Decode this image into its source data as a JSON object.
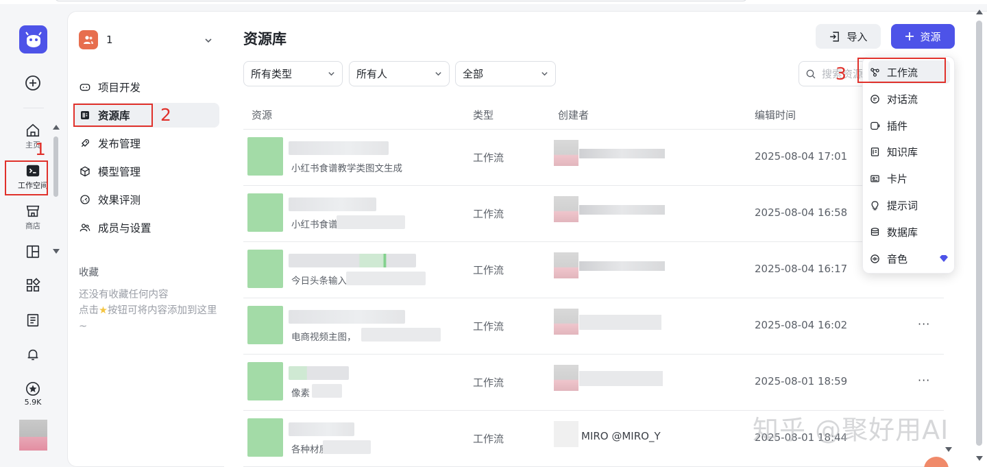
{
  "rail": {
    "items": [
      {
        "name": "create-icon",
        "label": ""
      },
      {
        "name": "home-icon",
        "label": "主页"
      },
      {
        "name": "workspace-icon",
        "label": "工作空间"
      },
      {
        "name": "store-icon",
        "label": "商店"
      },
      {
        "name": "layout-icon",
        "label": ""
      },
      {
        "name": "apps-icon",
        "label": ""
      },
      {
        "name": "docs-icon",
        "label": ""
      },
      {
        "name": "bell-icon",
        "label": ""
      },
      {
        "name": "star-icon",
        "label": "5.9K"
      }
    ]
  },
  "annotations": {
    "n1": "1",
    "n2": "2",
    "n3": "3"
  },
  "team": {
    "name": "1"
  },
  "sidebar": {
    "items": [
      {
        "label": "项目开发",
        "icon": "gamepad-icon"
      },
      {
        "label": "资源库",
        "icon": "library-icon"
      },
      {
        "label": "发布管理",
        "icon": "rocket-icon"
      },
      {
        "label": "模型管理",
        "icon": "cube-icon"
      },
      {
        "label": "效果评测",
        "icon": "gauge-icon"
      },
      {
        "label": "成员与设置",
        "icon": "members-icon"
      }
    ],
    "favorites_title": "收藏",
    "favorites_empty_1": "还没有收藏任何内容",
    "favorites_empty_2_pre": "点击",
    "favorites_empty_2_post": "按钮可将内容添加到这里~"
  },
  "main": {
    "title": "资源库",
    "import_label": "导入",
    "add_label": "资源",
    "filters": [
      "所有类型",
      "所有人",
      "全部"
    ],
    "search_placeholder": "搜索资源",
    "columns": {
      "resource": "资源",
      "type": "类型",
      "creator": "创建者",
      "edited": "编辑时间"
    },
    "rows": [
      {
        "desc": "小红书食谱教学类图文生成",
        "type": "工作流",
        "time": "2025-08-04 17:01",
        "creator": ""
      },
      {
        "desc": "小红书食谱",
        "type": "工作流",
        "time": "2025-08-04 16:58",
        "creator": ""
      },
      {
        "desc": "今日头条输入",
        "type": "工作流",
        "time": "2025-08-04 16:17",
        "creator": ""
      },
      {
        "desc": "电商视频主图，",
        "type": "工作流",
        "time": "2025-08-04 16:02",
        "creator": ""
      },
      {
        "desc": "像素",
        "type": "工作流",
        "time": "2025-08-01 18:59",
        "creator": ""
      },
      {
        "desc": "各种材质",
        "type": "工作流",
        "time": "2025-08-01 18:44",
        "creator": "MIRO @MIRO_Y"
      }
    ]
  },
  "menu": {
    "items": [
      {
        "label": "工作流",
        "icon": "workflow-icon"
      },
      {
        "label": "对话流",
        "icon": "chatflow-icon"
      },
      {
        "label": "插件",
        "icon": "plugin-icon"
      },
      {
        "label": "知识库",
        "icon": "knowledge-icon"
      },
      {
        "label": "卡片",
        "icon": "card-icon"
      },
      {
        "label": "提示词",
        "icon": "prompt-icon"
      },
      {
        "label": "数据库",
        "icon": "database-icon"
      },
      {
        "label": "音色",
        "icon": "voice-icon"
      }
    ]
  },
  "watermark": "知乎 @聚好用AI",
  "colors": {
    "accent": "#4d53e8",
    "annotation": "#e0302a",
    "thumb": "#a3dba7"
  }
}
